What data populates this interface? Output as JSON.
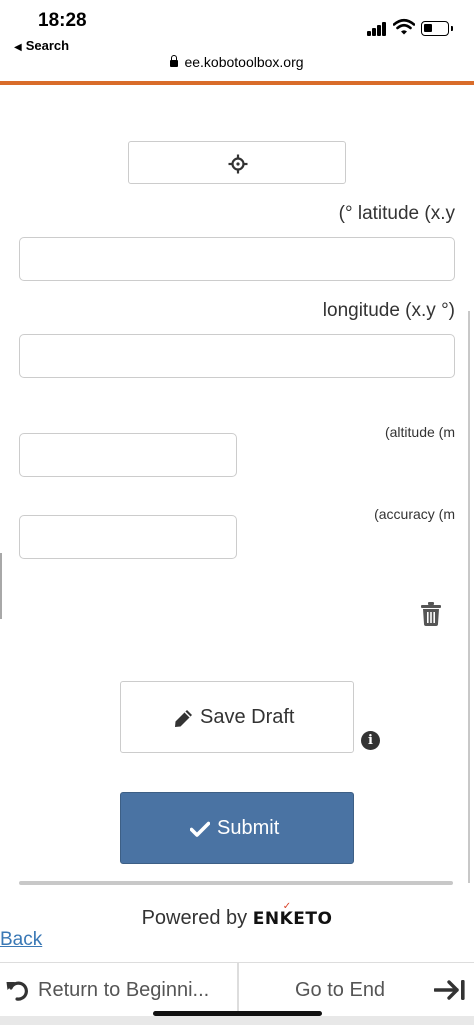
{
  "status_bar": {
    "time": "18:28",
    "back_app": "Search"
  },
  "browser": {
    "url": "ee.kobotoolbox.org"
  },
  "form": {
    "geo_button_icon": "crosshairs-icon",
    "latitude_label": "(° latitude (x.y",
    "latitude_value": "",
    "longitude_label": "longitude (x.y °)",
    "longitude_value": "",
    "altitude_label": "(altitude (m",
    "altitude_value": "",
    "accuracy_label": "(accuracy (m",
    "accuracy_value": "",
    "delete_icon": "trash-icon"
  },
  "actions": {
    "save_draft_label": "Save Draft",
    "submit_label": "Submit",
    "info_icon": "info-icon"
  },
  "footer": {
    "powered_by": "Powered by",
    "brand": "ENKETO",
    "back_link": "Back"
  },
  "bottom_nav": {
    "return_label": "Return to Beginni...",
    "end_label": "Go to End"
  },
  "colors": {
    "accent": "#d96c2a",
    "submit": "#4a73a3",
    "link": "#3a78b5"
  }
}
